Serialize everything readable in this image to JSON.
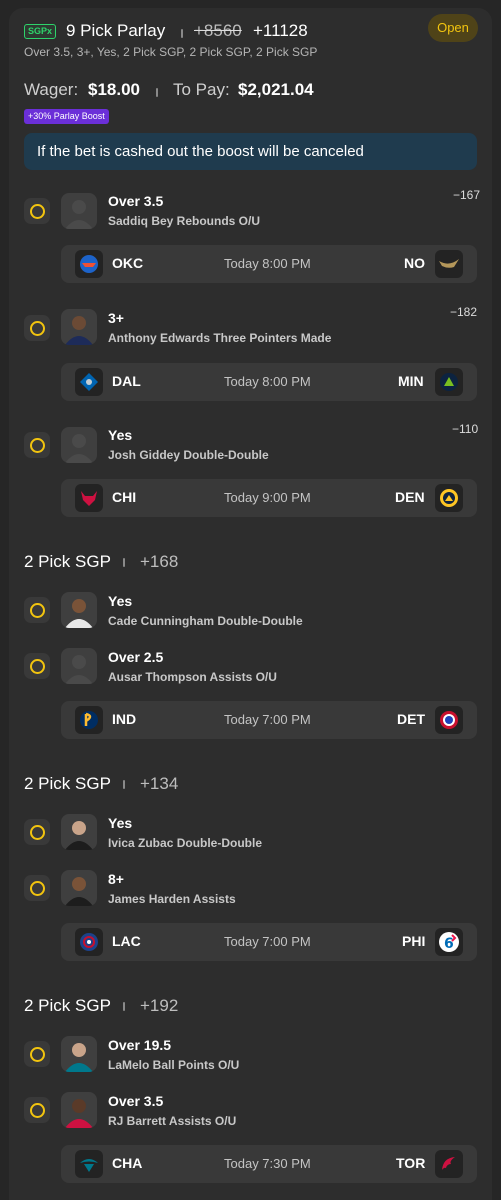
{
  "header": {
    "badge": "SGPx",
    "title": "9 Pick Parlay",
    "original_odds": "+8560",
    "boosted_odds": "+11128",
    "summary": "Over 3.5, 3+, Yes, 2 Pick SGP, 2 Pick SGP, 2 Pick SGP",
    "status": "Open"
  },
  "wager": {
    "wager_label": "Wager:",
    "wager_value": "$18.00",
    "pay_label": "To Pay:",
    "pay_value": "$2,021.04"
  },
  "boost_badge": "+30% Parlay Boost",
  "notice": "If the bet is cashed out the boost will be canceled",
  "singles": [
    {
      "line": "Over 3.5",
      "desc": "Saddiq Bey Rebounds O/U",
      "odds": "−167",
      "game": {
        "away": "OKC",
        "time": "Today 8:00 PM",
        "home": "NO"
      }
    },
    {
      "line": "3+",
      "desc": "Anthony Edwards Three Pointers Made",
      "odds": "−182",
      "game": {
        "away": "DAL",
        "time": "Today 8:00 PM",
        "home": "MIN"
      }
    },
    {
      "line": "Yes",
      "desc": "Josh Giddey Double-Double",
      "odds": "−110",
      "game": {
        "away": "CHI",
        "time": "Today 9:00 PM",
        "home": "DEN"
      }
    }
  ],
  "sgps": [
    {
      "title": "2 Pick SGP",
      "odds": "+168",
      "picks": [
        {
          "line": "Yes",
          "desc": "Cade Cunningham Double-Double"
        },
        {
          "line": "Over 2.5",
          "desc": "Ausar Thompson Assists O/U"
        }
      ],
      "game": {
        "away": "IND",
        "time": "Today 7:00 PM",
        "home": "DET"
      }
    },
    {
      "title": "2 Pick SGP",
      "odds": "+134",
      "picks": [
        {
          "line": "Yes",
          "desc": "Ivica Zubac Double-Double"
        },
        {
          "line": "8+",
          "desc": "James Harden Assists"
        }
      ],
      "game": {
        "away": "LAC",
        "time": "Today 7:00 PM",
        "home": "PHI"
      }
    },
    {
      "title": "2 Pick SGP",
      "odds": "+192",
      "picks": [
        {
          "line": "Over 19.5",
          "desc": "LaMelo Ball Points O/U"
        },
        {
          "line": "Over 3.5",
          "desc": "RJ Barrett Assists O/U"
        }
      ],
      "game": {
        "away": "CHA",
        "time": "Today 7:30 PM",
        "home": "TOR"
      }
    }
  ],
  "colors": {
    "background": "#262626",
    "card": "#2d2d2d",
    "accent_yellow": "#f2c40f",
    "sgpx_green": "#2ed36b",
    "boost_purple": "#6b2fd8",
    "notice_blue": "#1f3b4e"
  }
}
